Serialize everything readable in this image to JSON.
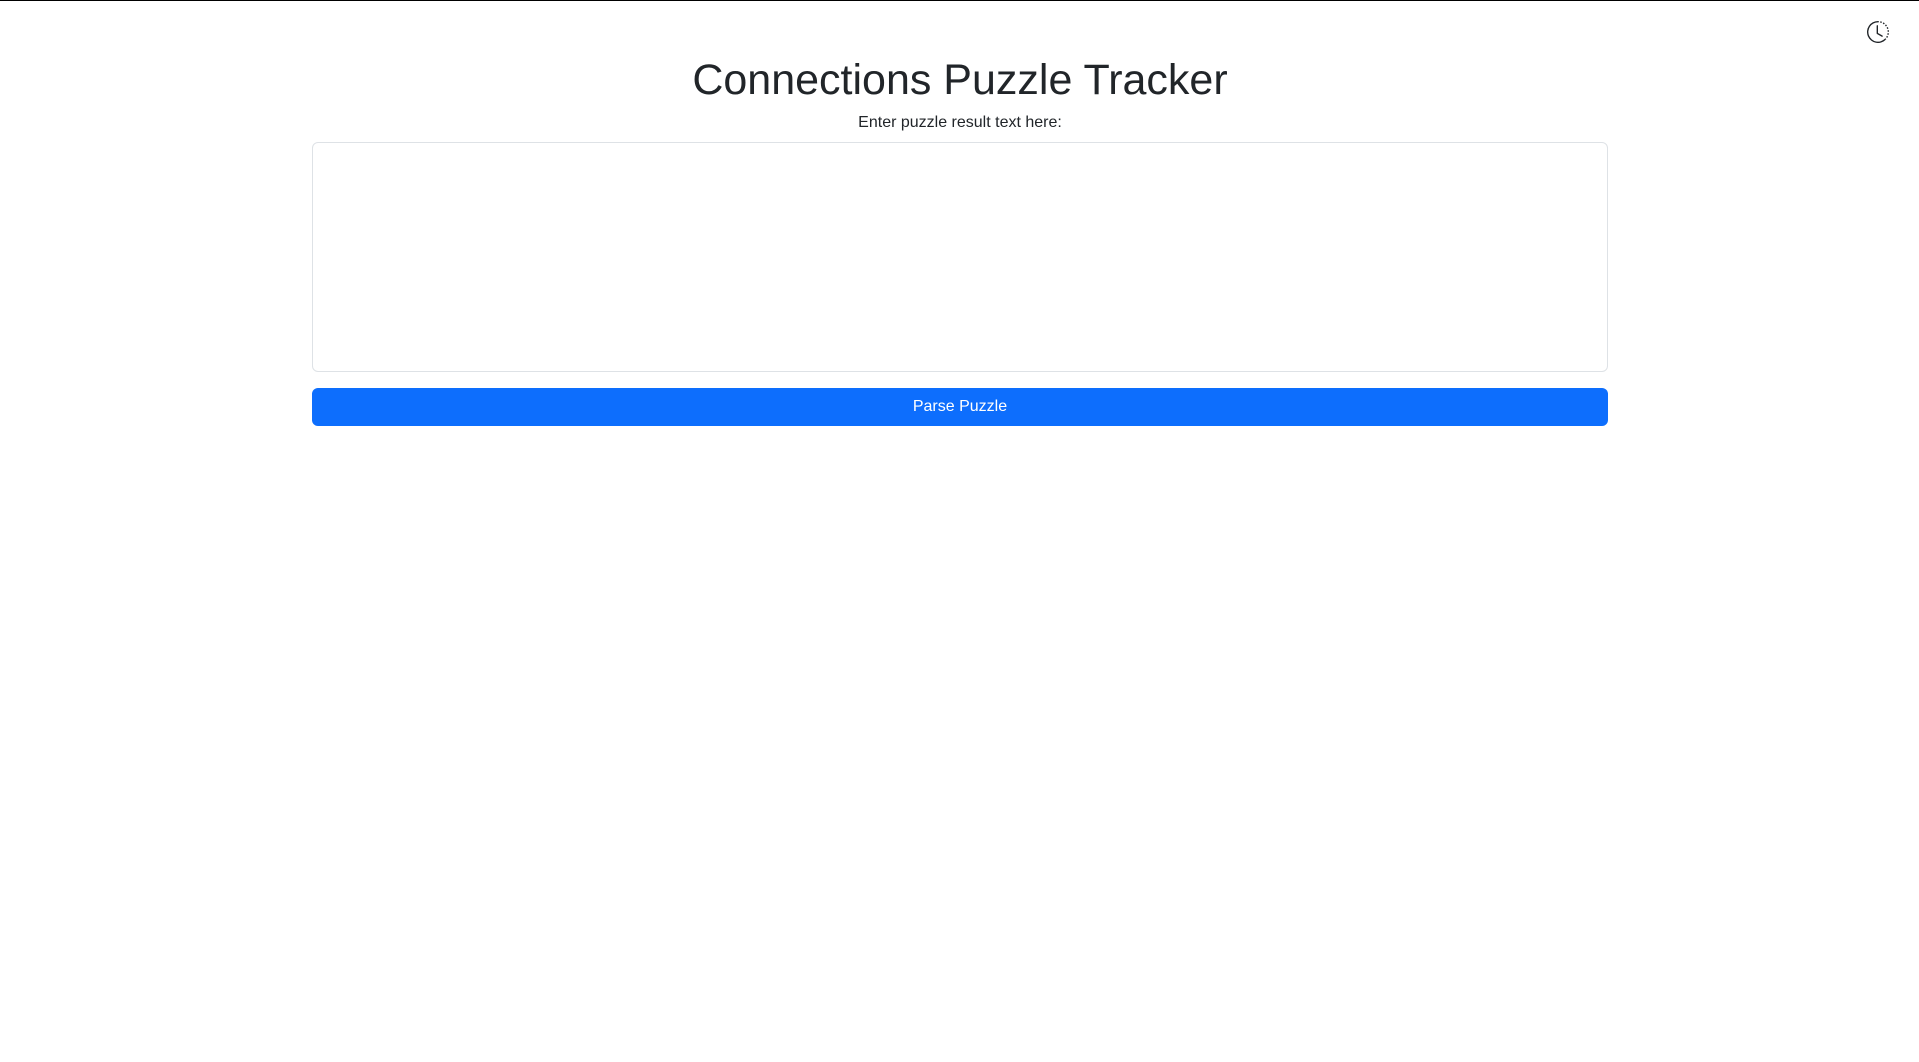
{
  "header": {
    "history_icon": "history-icon"
  },
  "main": {
    "title": "Connections Puzzle Tracker",
    "prompt_label": "Enter puzzle result text here:",
    "textarea_value": "",
    "parse_button_label": "Parse Puzzle"
  },
  "colors": {
    "primary": "#0d6efd",
    "text": "#212529",
    "border": "#dee2e6",
    "background": "#ffffff"
  }
}
